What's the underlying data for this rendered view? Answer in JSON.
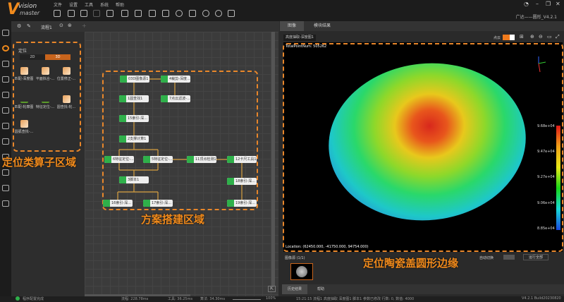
{
  "app": {
    "logo_v": "V",
    "logo_line1": "vision",
    "logo_line2": "master",
    "project_title": "广达——圆形_V4.2.1"
  },
  "menu": [
    "文件",
    "设置",
    "工具",
    "系统",
    "帮助"
  ],
  "toolbar_icons": [
    "save-icon",
    "open-folder-icon",
    "scheme-icon",
    "disabled-icon",
    "global-var-icon",
    "camera-icon",
    "communication-icon",
    "controller-icon",
    "trigger-icon",
    "gear-icon",
    "scene-icon",
    "run-once-icon",
    "run-loop-icon",
    "export-icon"
  ],
  "flow": {
    "tab": "流程1"
  },
  "toolbox": {
    "title": "定位",
    "tabs": [
      "2D",
      "3D"
    ],
    "active_tab": "3D",
    "items": [
      "匹配-深度图",
      "平面拟合-...",
      "位置修正-...",
      "匹配-轮廓图",
      "特征定位-...",
      "圆查找-轮...",
      "圆弧查找-..."
    ]
  },
  "nodes": [
    "03D图像源1",
    "4裁剪-深度...",
    "1圆查找1",
    "7点云滤波-...",
    "15索引-深...",
    "2支撑计算1",
    "6特征定位-...",
    "5特征定位-...",
    "11顶点检测1",
    "12卡尺工具1",
    "3脚本1",
    "18索引-深...",
    "16索引-深...",
    "17索引-深...",
    "19索引-深..."
  ],
  "annotations": {
    "toolbox": "定位类算子区域",
    "canvas": "方案搭建区域",
    "image": "定位陶瓷盖圆形边缘"
  },
  "image_panel": {
    "tabs": [
      "图像",
      "模块结果"
    ],
    "source_select": "高度抽取-深度图1",
    "point_cloud_label": "点云",
    "total_points": "TotalPointNum: 505262",
    "location": "Location: (62450.000, -41750.000, 94754.000)",
    "colorbar": [
      "9.68e+04",
      "9.47e+04",
      "9.27e+04",
      "9.06e+04",
      "8.85e+04"
    ],
    "image_source": "图像源 (1/1)",
    "auto_switch": "自动切换",
    "run_all": "运行全部"
  },
  "bottom_tabs": [
    "历史结果",
    "帮助"
  ],
  "log_line": "15:21:15  流程1 高度抽取 深度图1 脚本1 参数已修改  行数: 0,  数值: 4000",
  "version": "V4.2.1 Build20230820",
  "status": {
    "text": "程序配置完成",
    "flow_time": "流程: 228.78ms",
    "tool_time": "工具: 36.25ms",
    "algo_time": "算法: 34.30ms",
    "zoom": "100%"
  },
  "colors": {
    "accent": "#e8862a",
    "node_green": "#2fb04a"
  }
}
